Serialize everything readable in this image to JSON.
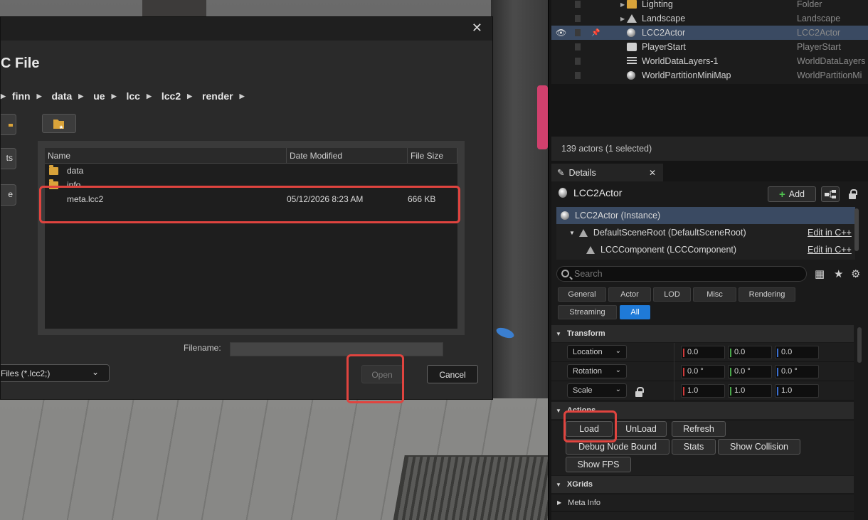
{
  "dialog": {
    "title": "C File",
    "breadcrumbs": [
      "finn",
      "data",
      "ue",
      "lcc",
      "lcc2",
      "render"
    ],
    "side_buttons": [
      "",
      "ts",
      "e"
    ],
    "columns": [
      "Name",
      "Date Modified",
      "File Size"
    ],
    "files": [
      {
        "name": "data",
        "date": "",
        "size": "",
        "type": "folder"
      },
      {
        "name": "info",
        "date": "",
        "size": "",
        "type": "folder"
      },
      {
        "name": "meta.lcc2",
        "date": "05/12/2026  8:23 AM",
        "size": "666 KB",
        "type": "file"
      }
    ],
    "filename_label": "Filename:",
    "filename_value": "",
    "filter": "Files (*.lcc2;)",
    "open_label": "Open",
    "cancel_label": "Cancel"
  },
  "outliner": {
    "rows": [
      {
        "name": "Lighting",
        "type": "Folder",
        "icon": "folder-icon"
      },
      {
        "name": "Landscape",
        "type": "Landscape",
        "icon": "mountain-icon"
      },
      {
        "name": "LCC2Actor",
        "type": "LCC2Actor",
        "icon": "sphere-icon",
        "selected": true
      },
      {
        "name": "PlayerStart",
        "type": "PlayerStart",
        "icon": "player-icon"
      },
      {
        "name": "WorldDataLayers-1",
        "type": "WorldDataLayers",
        "icon": "layers-icon"
      },
      {
        "name": "WorldPartitionMiniMap",
        "type": "WorldPartitionMi",
        "icon": "sphere-icon"
      }
    ],
    "actor_count": "139 actors (1 selected)"
  },
  "details": {
    "tab_label": "Details",
    "actor_name": "LCC2Actor",
    "add_label": "Add",
    "components": [
      {
        "label": "LCC2Actor (Instance)",
        "link": ""
      },
      {
        "label": "DefaultSceneRoot (DefaultSceneRoot)",
        "link": "Edit in C++"
      },
      {
        "label": "LCCComponent (LCCComponent)",
        "link": "Edit in C++"
      }
    ],
    "search_placeholder": "Search",
    "filters": [
      "General",
      "Actor",
      "LOD",
      "Misc",
      "Rendering",
      "Streaming",
      "All"
    ],
    "active_filter": "All",
    "transform": {
      "title": "Transform",
      "rows": [
        {
          "label": "Location",
          "x": "0.0",
          "y": "0.0",
          "z": "0.0"
        },
        {
          "label": "Rotation",
          "x": "0.0 °",
          "y": "0.0 °",
          "z": "0.0 °"
        },
        {
          "label": "Scale",
          "x": "1.0",
          "y": "1.0",
          "z": "1.0"
        }
      ]
    },
    "actions": {
      "title": "Actions",
      "buttons": [
        "Load",
        "UnLoad",
        "Refresh",
        "Debug Node Bound",
        "Stats",
        "Show Collision",
        "Show FPS"
      ]
    },
    "xgrids_title": "XGrids",
    "meta_info_title": "Meta Info"
  },
  "colors": {
    "selection": "#3a4a62",
    "highlight_box": "#e0443f",
    "active_filter": "#1f7ad8",
    "axis_x": "#d03a3a",
    "axis_y": "#4aa84a",
    "axis_z": "#3a6fd0"
  }
}
